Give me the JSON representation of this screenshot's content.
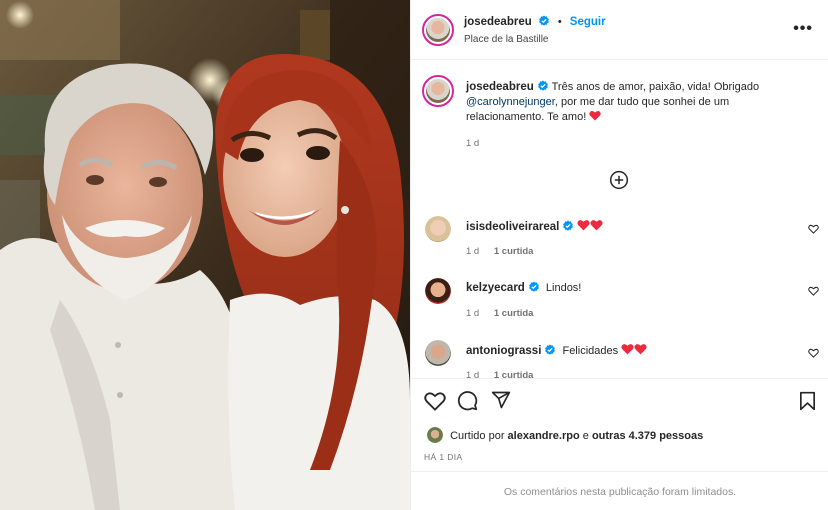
{
  "post": {
    "author": "josedeabreu",
    "follow_label": "Seguir",
    "separator": "•",
    "location": "Place de la Bastille",
    "more_label": "•••"
  },
  "caption": {
    "username": "josedeabreu",
    "text_before_mention": "Três anos de amor, paixão, vida! Obrigado",
    "mention": "@carolynnejunger",
    "text_after_mention": ", por me dar tudo que sonhei de um relacionamento. Te amo!",
    "time": "1 d"
  },
  "comments": [
    {
      "username": "isisdeoliveirareal",
      "text": "",
      "hearts": 2,
      "time": "1 d",
      "likes": "1 curtida"
    },
    {
      "username": "kelzyecard",
      "text": "Lindos!",
      "hearts": 0,
      "time": "1 d",
      "likes": "1 curtida"
    },
    {
      "username": "antoniograssi",
      "text": "Felicidades",
      "hearts": 2,
      "time": "1 d",
      "likes": "1 curtida"
    }
  ],
  "actions": {
    "liked_by_prefix": "Curtido por",
    "liked_by_user": "alexandre.rpo",
    "liked_by_connector": "e",
    "liked_by_others": "outras 4.379 pessoas",
    "time_ago": "HÁ 1 DIA",
    "comments_limited": "Os comentários nesta publicação foram limitados."
  },
  "colors": {
    "accent_blue": "#0095f6",
    "verified_blue": "#0095f6",
    "heart_red": "#ed2b3f",
    "mention": "#00376b",
    "muted": "#737373"
  },
  "icons": {
    "verified": "verified-badge-icon",
    "heart": "heart-icon",
    "comment": "comment-icon",
    "share": "share-icon",
    "save": "bookmark-icon",
    "more": "more-options-icon",
    "load_more": "plus-circle-icon"
  }
}
